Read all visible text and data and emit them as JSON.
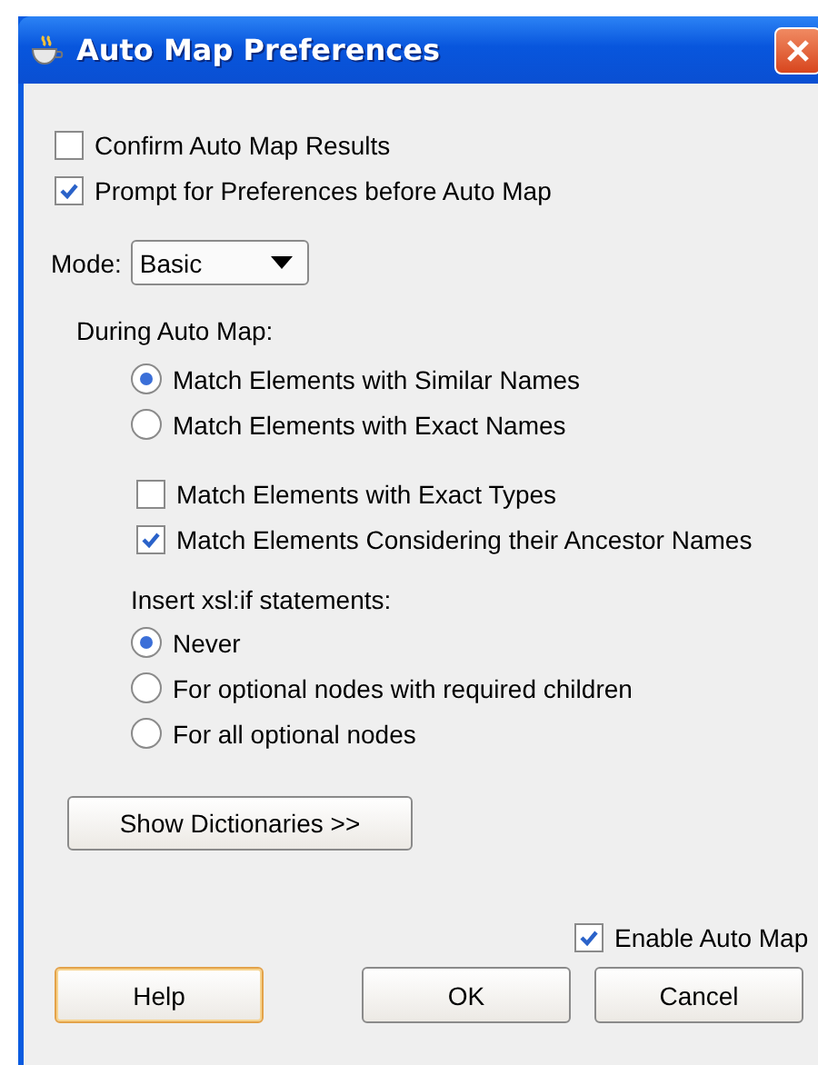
{
  "window": {
    "title": "Auto Map Preferences"
  },
  "options": [
    {
      "label": "Confirm Auto Map Results",
      "checked": false
    },
    {
      "label": "Prompt for Preferences before Auto Map",
      "checked": true
    }
  ],
  "mode": {
    "label": "Mode:",
    "value": "Basic"
  },
  "during_auto_map": {
    "heading": "During Auto Map:",
    "match_by": [
      {
        "label": "Match Elements with Similar Names",
        "selected": true
      },
      {
        "label": "Match Elements with Exact Names",
        "selected": false
      }
    ],
    "checks": [
      {
        "label": "Match Elements with Exact Types",
        "checked": false
      },
      {
        "label": "Match Elements Considering their Ancestor Names",
        "checked": true
      }
    ],
    "xsl_heading": "Insert xsl:if statements:",
    "xsl_if": [
      {
        "label": "Never",
        "selected": true
      },
      {
        "label": "For optional nodes with required children",
        "selected": false
      },
      {
        "label": "For all optional nodes",
        "selected": false
      }
    ]
  },
  "show_dictionaries": "Show Dictionaries >>",
  "enable_auto_map": {
    "label": "Enable Auto Map",
    "checked": true
  },
  "buttons": [
    {
      "label": "Help",
      "focused": true
    },
    {
      "label": "OK",
      "focused": false
    },
    {
      "label": "Cancel",
      "focused": false
    }
  ]
}
